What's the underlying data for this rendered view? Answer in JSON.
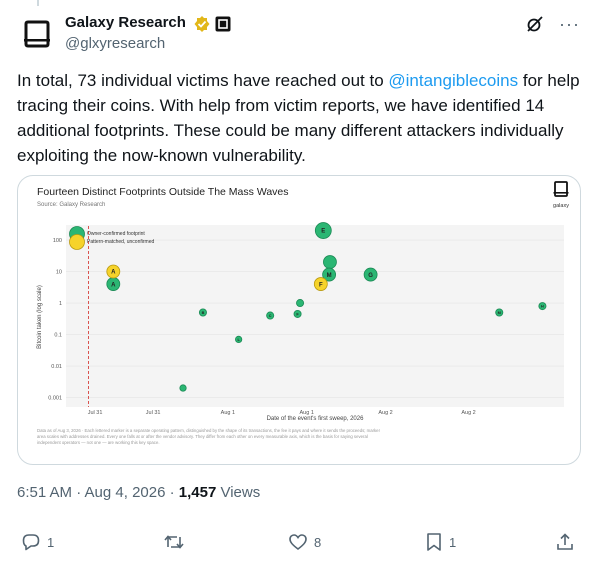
{
  "author": {
    "name": "Galaxy Research",
    "handle": "@glxyresearch"
  },
  "tweet": {
    "text_before": "In total, 73 individual victims have reached out to ",
    "mention": "@intangiblecoins",
    "text_after": " for help tracing their coins. With help from victim reports, we have identified 14 additional footprints. These could be many different attackers individually exploiting the now-known vulnerability."
  },
  "chart": {
    "title": "Fourteen Distinct Footprints Outside The Mass Waves",
    "source": "Source: Galaxy Research",
    "brand": "galaxy",
    "xlabel": "Date of the event's first sweep, 2026",
    "ylabel": "Bitcoin taken (log scale)",
    "legend": [
      "Owner-confirmed footprint",
      "Pattern-matched, unconfirmed"
    ],
    "footnote_1": "Data as of Aug 3, 2026 · Each lettered marker is a separate operating pattern, distinguished by the shape of its transactions, the fee it pays and where it sends the proceeds; marker",
    "footnote_2": "area scales with addresses drained. Every one falls at or after the vendor advisory. They differ from each other on every measurable axis, which is the basis for saying several",
    "footnote_3": "independent operators — not one — are working this key space."
  },
  "chart_data": {
    "type": "scatter",
    "title": "Fourteen Distinct Footprints Outside The Mass Waves",
    "xlabel": "Date of the event's first sweep, 2026",
    "ylabel": "Bitcoin taken (log scale)",
    "y_scale": "log",
    "ylim": [
      0.0005,
      300
    ],
    "ytick_labels": [
      "100",
      "10",
      "1",
      "0.1",
      "0.01",
      "0.001"
    ],
    "xtick_labels": [
      "Jul 31",
      "Jul 31",
      "Aug 1",
      "Aug 1",
      "Aug 2",
      "Aug 2"
    ],
    "legend_placement": "top-left",
    "series": [
      {
        "name": "Owner-confirmed footprint",
        "color": "#2bb673",
        "points": [
          {
            "label": "A",
            "x": 0.57,
            "y": 4
          },
          {
            "label": "",
            "x": 1.41,
            "y": 0.002
          },
          {
            "label": "B",
            "x": 1.65,
            "y": 0.5
          },
          {
            "label": "L",
            "x": 2.08,
            "y": 0.07
          },
          {
            "label": "C",
            "x": 2.46,
            "y": 0.4
          },
          {
            "label": "F",
            "x": 2.79,
            "y": 0.45
          },
          {
            "label": "",
            "x": 2.82,
            "y": 1
          },
          {
            "label": "E",
            "x": 3.1,
            "y": 200
          },
          {
            "label": "",
            "x": 3.18,
            "y": 20
          },
          {
            "label": "M",
            "x": 3.17,
            "y": 8
          },
          {
            "label": "G",
            "x": 3.67,
            "y": 8
          },
          {
            "label": "M",
            "x": 5.22,
            "y": 0.5
          },
          {
            "label": "H",
            "x": 5.74,
            "y": 0.8
          }
        ]
      },
      {
        "name": "Pattern-matched, unconfirmed",
        "color": "#f6d32b",
        "points": [
          {
            "label": "A",
            "x": 0.57,
            "y": 10
          },
          {
            "label": "F",
            "x": 3.07,
            "y": 4
          }
        ]
      }
    ],
    "annotations": [
      "advisory line at x = 0.35"
    ]
  },
  "meta": {
    "time": "6:51 AM · Aug 4, 2026 · ",
    "views": "1,457",
    "views_label": " Views"
  },
  "actions": {
    "replies": "1",
    "retweets": "",
    "likes": "8",
    "bookmarks": "1"
  },
  "colors": {
    "accent": "#1d9bf0",
    "badge_gold": "#e2b719",
    "confirmed": "#2bb673",
    "unconfirmed": "#f6d32b",
    "advisory": "#d9534f"
  }
}
